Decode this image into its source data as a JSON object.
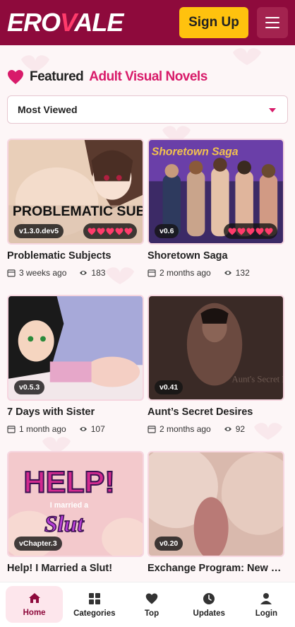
{
  "header": {
    "logo_part1": "ERO",
    "logo_part2": "V",
    "logo_part3": "ALE",
    "signup_label": "Sign Up"
  },
  "section": {
    "title_main": "Featured",
    "title_accent": "Adult Visual Novels"
  },
  "sort": {
    "selected": "Most Viewed"
  },
  "cards": [
    {
      "title": "Problematic Subjects",
      "version": "v1.3.0.dev5",
      "date": "3 weeks ago",
      "views": "183",
      "rating": 5
    },
    {
      "title": "Shoretown Saga",
      "version": "v0.6",
      "date": "2 months ago",
      "views": "132",
      "rating": 5
    },
    {
      "title": "7 Days with Sister",
      "version": "v0.5.3",
      "date": "1 month ago",
      "views": "107"
    },
    {
      "title": "Aunt’s Secret Desires",
      "version": "v0.41",
      "date": "2 months ago",
      "views": "92"
    },
    {
      "title": "Help! I Married a Slut!",
      "version": "vChapter.3",
      "date": "",
      "views": ""
    },
    {
      "title": "Exchange Program: New Beginnings",
      "version": "v0.20",
      "date": "",
      "views": ""
    }
  ],
  "thumb_text": {
    "c1": "PROBLEMATIC SUBJECTS",
    "c2": "Shoretown Saga",
    "c4": "Aunt's Secret Desires",
    "c5_line1": "HELP!",
    "c5_line2": "I married a",
    "c5_line3": "Slut"
  },
  "nav": [
    {
      "label": "Home",
      "icon": "home-icon"
    },
    {
      "label": "Categories",
      "icon": "grid-icon"
    },
    {
      "label": "Top",
      "icon": "heart-icon"
    },
    {
      "label": "Updates",
      "icon": "clock-icon"
    },
    {
      "label": "Login",
      "icon": "user-icon"
    }
  ],
  "colors": {
    "brand": "#8e0a3c",
    "accent": "#d81b6a",
    "button": "#ffc20e"
  }
}
